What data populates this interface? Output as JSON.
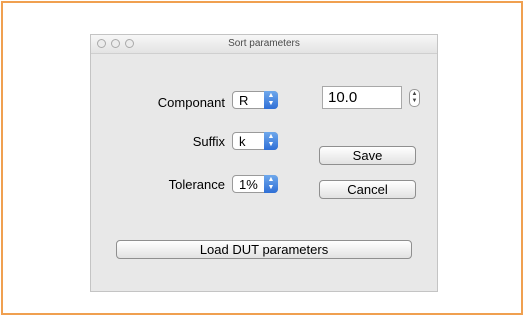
{
  "window": {
    "title": "Sort parameters"
  },
  "form": {
    "componant_label": "Componant",
    "componant_value": "R",
    "suffix_label": "Suffix",
    "suffix_value": "k",
    "tolerance_label": "Tolerance",
    "tolerance_value": "1%",
    "value_field": "10.0"
  },
  "buttons": {
    "save": "Save",
    "cancel": "Cancel",
    "load": "Load DUT parameters"
  },
  "colors": {
    "frame_border": "#f0a050",
    "popup_accent": "#2f6fd6"
  },
  "icons": {
    "popup_arrows": "up-down-arrows",
    "stepper": "stepper-arrows"
  }
}
